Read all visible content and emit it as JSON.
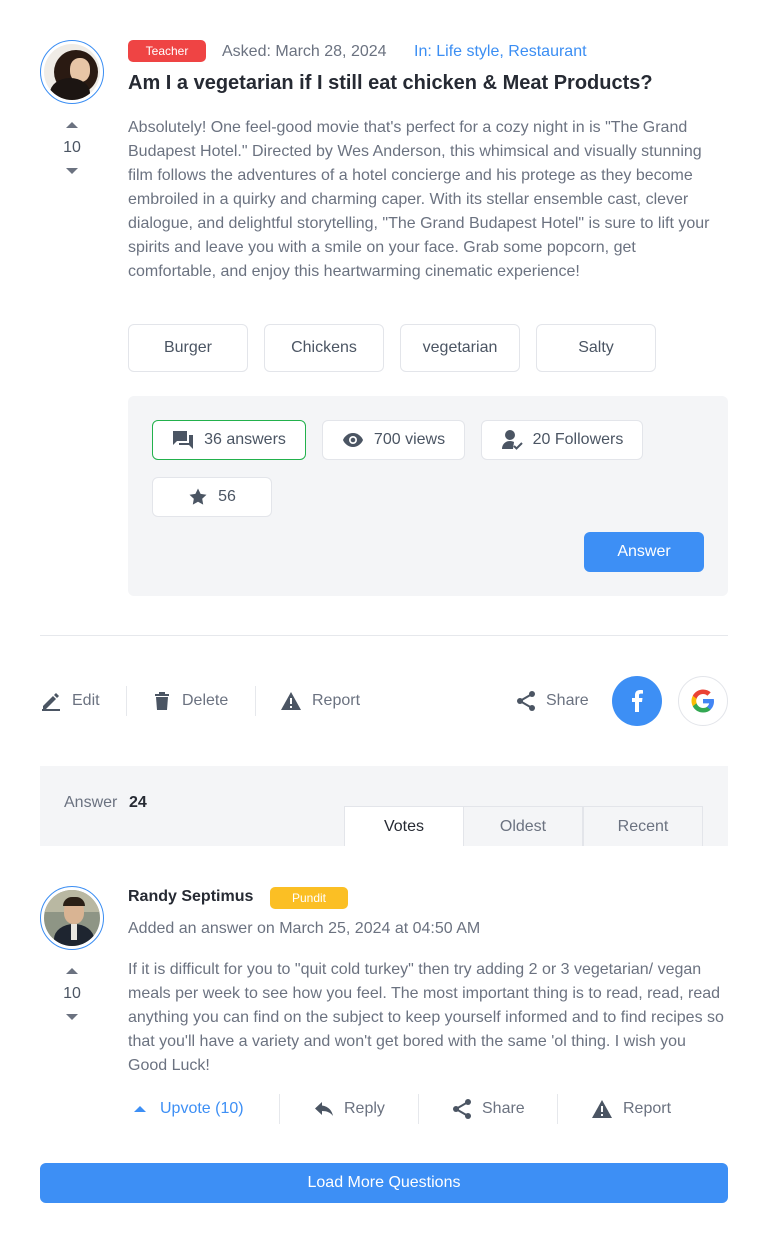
{
  "question": {
    "badge": "Teacher",
    "asked": "Asked: March 28, 2024",
    "in_prefix": "In: Life style, Restaurant",
    "votes": "10",
    "title": "Am I a vegetarian if I still eat chicken & Meat Products?",
    "body": "Absolutely! One feel-good movie that's perfect for a cozy night in is \"The Grand Budapest Hotel.\" Directed by Wes Anderson, this whimsical and visually stunning film follows the adventures of a hotel concierge and his protege as they become embroiled in a quirky and charming caper. With its stellar ensemble cast, clever dialogue, and delightful storytelling, \"The Grand Budapest Hotel\" is sure to lift your spirits and leave you with a smile on your face. Grab some popcorn, get comfortable, and enjoy this heartwarming cinematic experience!",
    "tags": [
      "Burger",
      "Chickens",
      "vegetarian",
      "Salty"
    ],
    "stats": {
      "answers": "36 answers",
      "views": "700 views",
      "followers": "20 Followers",
      "stars": "56"
    },
    "answer_button": "Answer"
  },
  "actions": {
    "edit": "Edit",
    "delete": "Delete",
    "report": "Report",
    "share": "Share"
  },
  "answers_section": {
    "label": "Answer",
    "count": "24",
    "tabs": [
      "Votes",
      "Oldest",
      "Recent"
    ],
    "active_tab": "Votes"
  },
  "answer": {
    "author": "Randy Septimus",
    "badge": "Pundit",
    "added": "Added an answer on March 25, 2024 at 04:50 AM",
    "votes": "10",
    "body": "If it is difficult for you to \"quit cold turkey\" then try adding 2 or 3 vegetarian/ vegan meals per week to see how you feel. The most important thing is to read, read, read anything you can find on the subject to keep yourself informed and to find recipes so that you'll have a variety and won't get bored with the same 'ol thing. I wish you Good Luck!",
    "upvote": "Upvote (10)",
    "reply": "Reply",
    "share": "Share",
    "report": "Report"
  },
  "load_more": "Load More Questions",
  "colors": {
    "accent": "#3d8ff5",
    "teacher_badge": "#ef4444",
    "pundit_badge": "#fbbf24",
    "active_stat_border": "#22b14c"
  }
}
